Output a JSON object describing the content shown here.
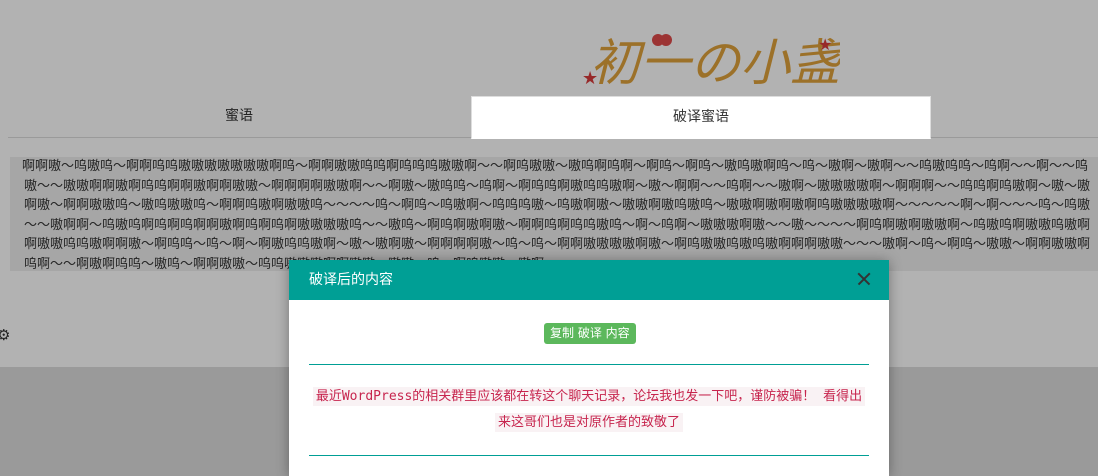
{
  "header": {
    "logo_text": "初一の小盏"
  },
  "tabs": [
    {
      "label": "蜜语",
      "active": false
    },
    {
      "label": "破译蜜语",
      "active": true
    }
  ],
  "cipher": {
    "text": "啊啊嗷～呜嗷呜～啊啊呜呜嗷嗷嗷嗷嗷嗷嗷啊呜～啊啊嗷嗷呜呜啊呜呜呜嗷嗷啊～～啊呜嗷嗷～嗷呜啊呜啊～啊呜～啊呜～嗷呜嗷啊呜～呜～嗷啊～嗷啊～～呜嗷呜呜～呜啊～～啊～～呜嗷～～嗷嗷啊啊嗷啊呜呜啊啊嗷啊啊嗷嗷～啊啊啊啊嗷嗷啊～～啊嗷～嗷呜呜～呜啊～啊呜呜啊嗷呜呜嗷啊～嗷～啊啊～～呜啊～～嗷啊～嗷嗷嗷嗷啊～啊啊啊～～呜呜啊呜嗷啊～嗷～嗷啊嗷～啊啊嗷嗷呜～嗷呜嗷嗷呜～啊啊呜嗷啊嗷嗷呜～～～～呜～啊呜～呜嗷啊～呜呜呜嗷～呜嗷啊嗷～嗷嗷啊嗷呜嗷呜～嗷嗷啊嗷啊嗷啊呜嗷嗷嗷嗷啊～～～～～啊～啊～～～呜～呜嗷～～嗷啊啊～呜嗷呜啊呜啊呜啊啊嗷啊呜啊呜啊嗷嗷嗷嗷呜～～嗷呜～啊呜啊嗷啊嗷～啊啊呜啊呜呜嗷呜～啊～呜啊～嗷嗷嗷啊嗷～～嗷～～～～啊呜啊嗷啊嗷嗷啊～呜嗷呜啊嗷嗷呜嗷啊啊嗷嗷呜呜嗷啊啊嗷～啊呜呜～呜～啊～啊嗷呜呜嗷啊～嗷～嗷啊嗷～啊啊啊啊嗷～呜～呜～啊啊嗷嗷嗷嗷啊嗷～啊呜嗷嗷呜嗷呜嗷啊啊啊嗷嗷～～～嗷啊～呜～啊呜～嗷嗷～啊啊嗷嗷啊呜啊～～啊嗷啊呜呜～嗷呜～啊啊嗷嗷～呜呜嗷嗷嗷啊啊嗷嗷～嗷嗷～呜～啊呜嗷嗷～嗷啊"
  },
  "modal": {
    "title": "破译后的内容",
    "copy_button_label": "复制 破译 内容",
    "result_text": "最近WordPress的相关群里应该都在转这个聊天记录，论坛我也发一下吧，谨防被骗！ 看得出来这哥们也是对原作者的致敬了"
  },
  "colors": {
    "modal_header": "#009f95",
    "copy_button": "#5cb85c",
    "result_text": "#c7254e",
    "result_bg": "#f9f2f4"
  },
  "icons": {
    "settings": "gear-icon",
    "close": "close-icon"
  }
}
